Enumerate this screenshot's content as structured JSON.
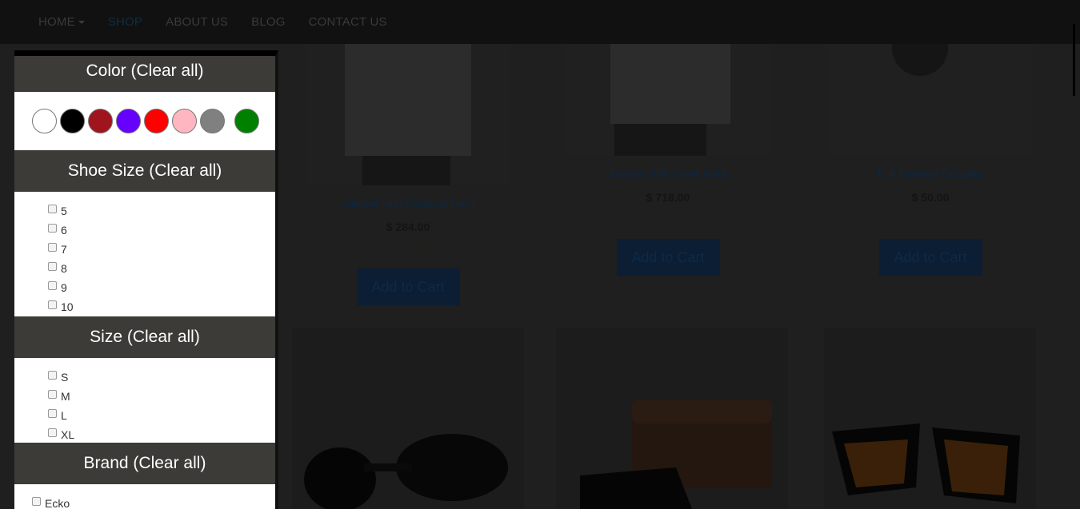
{
  "nav": {
    "items": [
      {
        "label": "HOME"
      },
      {
        "label": "SHOP"
      },
      {
        "label": "ABOUT US"
      },
      {
        "label": "BLOG"
      },
      {
        "label": "CONTACT US"
      }
    ]
  },
  "filters": {
    "color": {
      "title": "Color (Clear all)",
      "swatches": [
        "#ffffff",
        "#000000",
        "#a0141e",
        "#6600ff",
        "#ff0000",
        "#ffb6c1",
        "#808080",
        "#008000"
      ]
    },
    "shoe_size": {
      "title": "Shoe Size (Clear all)",
      "options": [
        "5",
        "6",
        "7",
        "8",
        "9",
        "10"
      ]
    },
    "size": {
      "title": "Size (Clear all)",
      "options": [
        "S",
        "M",
        "L",
        "XL"
      ]
    },
    "brand": {
      "title": "Brand (Clear all)",
      "options": [
        "Ecko"
      ]
    }
  },
  "products": [
    {
      "name": "Jumper with Contrast Hem",
      "price": "$ 284.00",
      "stars": "☆☆☆☆☆",
      "cart_label": "Add to Cart"
    },
    {
      "name": "Jumper With Crew Neck",
      "price": "$ 718.00",
      "stars": "☆☆☆☆☆",
      "cart_label": "Add to Cart"
    },
    {
      "name": "Full Fashion Goggles",
      "price": "$ 50.00",
      "stars": "☆☆☆☆☆",
      "cart_label": "Add to Cart"
    }
  ]
}
